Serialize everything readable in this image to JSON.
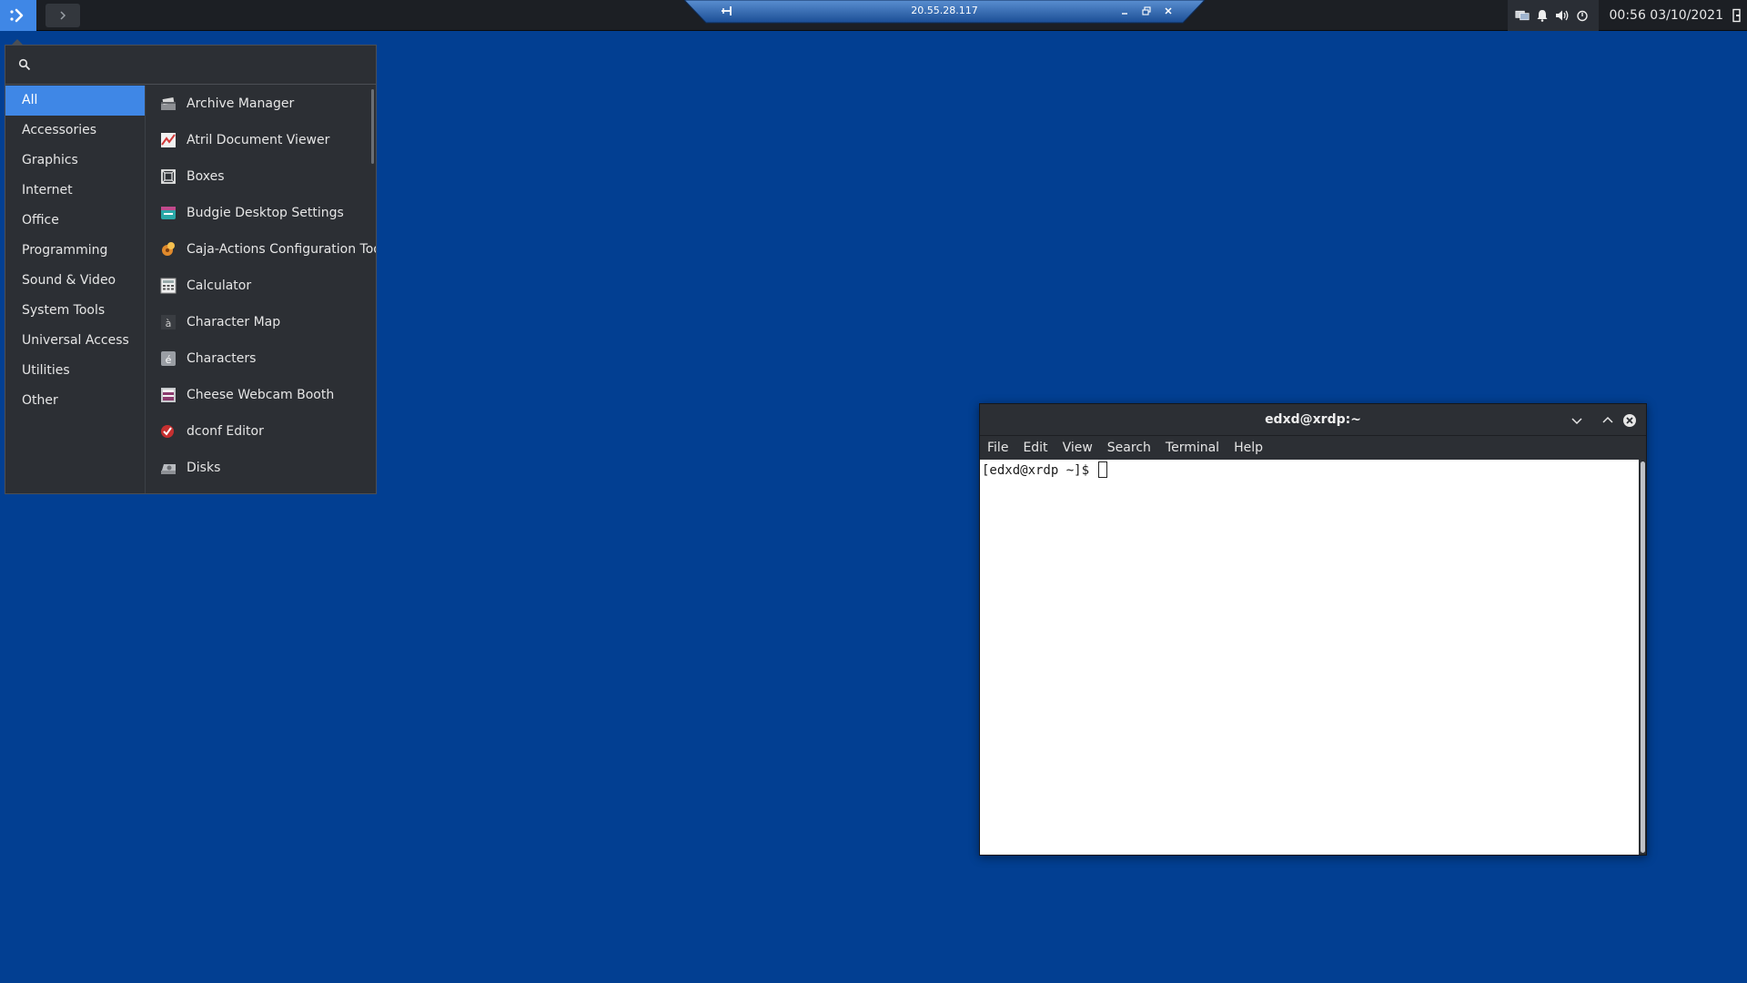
{
  "top_panel": {
    "menu_button": "app-menu-icon",
    "task_button": "chevron-right-icon",
    "clock": "00:56  03/10/2021",
    "tray_icons": [
      "network-icon",
      "bell-icon",
      "volume-icon",
      "power-icon"
    ]
  },
  "rdp_bar": {
    "title": "20.55.28.117",
    "pin": "pin-icon",
    "controls": [
      "minimize-icon",
      "restore-icon",
      "close-icon"
    ]
  },
  "app_menu": {
    "search": {
      "placeholder": "",
      "value": ""
    },
    "categories": [
      "All",
      "Accessories",
      "Graphics",
      "Internet",
      "Office",
      "Programming",
      "Sound & Video",
      "System Tools",
      "Universal Access",
      "Utilities",
      "Other"
    ],
    "selected_category": "All",
    "apps": [
      {
        "label": "Archive Manager",
        "icon": "archive-icon"
      },
      {
        "label": "Atril Document Viewer",
        "icon": "document-viewer-icon"
      },
      {
        "label": "Boxes",
        "icon": "boxes-icon"
      },
      {
        "label": "Budgie Desktop Settings",
        "icon": "budgie-settings-icon"
      },
      {
        "label": "Caja-Actions Configuration Tool",
        "icon": "caja-actions-icon"
      },
      {
        "label": "Calculator",
        "icon": "calculator-icon"
      },
      {
        "label": "Character Map",
        "icon": "character-map-icon"
      },
      {
        "label": "Characters",
        "icon": "characters-icon"
      },
      {
        "label": "Cheese Webcam Booth",
        "icon": "cheese-icon"
      },
      {
        "label": "dconf Editor",
        "icon": "dconf-icon"
      },
      {
        "label": "Disks",
        "icon": "disks-icon"
      }
    ]
  },
  "terminal": {
    "title": "edxd@xrdp:~",
    "menus": [
      "File",
      "Edit",
      "View",
      "Search",
      "Terminal",
      "Help"
    ],
    "prompt": "[edxd@xrdp ~]$ ",
    "controls": [
      "minimize-icon",
      "maximize-icon",
      "close-icon"
    ]
  },
  "colors": {
    "desktop": "#023f92",
    "accent": "#3f87e6",
    "panel": "#1c1f24",
    "menu_bg": "#2c2f34"
  }
}
